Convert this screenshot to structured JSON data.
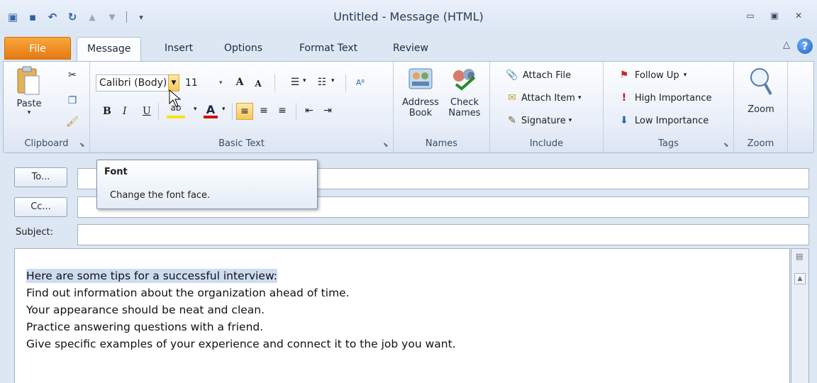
{
  "window": {
    "title": "Untitled  -  Message (HTML)",
    "controls": [
      "minimize",
      "restore",
      "close"
    ]
  },
  "quick_access": {
    "icons": [
      "outlook-menu-icon",
      "save-icon",
      "undo-icon",
      "redo-icon",
      "up-arrow-icon",
      "down-arrow-icon",
      "customize-icon"
    ]
  },
  "tabs": {
    "file": "File",
    "message": "Message",
    "insert": "Insert",
    "options": "Options",
    "format_text": "Format Text",
    "review": "Review"
  },
  "ribbon": {
    "clipboard": {
      "label": "Clipboard",
      "paste": "Paste"
    },
    "basic_text": {
      "label": "Basic Text",
      "font_name": "Calibri (Body)",
      "font_size": "11",
      "bold": "B",
      "italic": "I",
      "underline": "U"
    },
    "names": {
      "label": "Names",
      "address_book_1": "Address",
      "address_book_2": "Book",
      "check_names_1": "Check",
      "check_names_2": "Names"
    },
    "include": {
      "label": "Include",
      "attach_file": "Attach File",
      "attach_item": "Attach Item",
      "signature": "Signature"
    },
    "tags": {
      "label": "Tags",
      "follow_up": "Follow Up",
      "high_importance": "High Importance",
      "low_importance": "Low Importance"
    },
    "zoom": {
      "label": "Zoom",
      "zoom_button": "Zoom"
    }
  },
  "tooltip": {
    "title": "Font",
    "description": "Change the font face."
  },
  "fields": {
    "to_button": "To...",
    "cc_button": "Cc...",
    "subject_label": "Subject:",
    "to_value": "",
    "cc_value": "",
    "subject_value": ""
  },
  "message_body": {
    "lines": [
      "Here are some tips for a successful interview:",
      "Find out information about the organization ahead of time.",
      "Your appearance should be neat and clean.",
      "Practice answering questions with a friend.",
      "Give specific examples of your experience and connect it to the job you want."
    ]
  },
  "colors": {
    "file_tab": "#e77a12",
    "highlight_selection": "#cddcf2",
    "ribbon_bg": "#e8eef8"
  }
}
